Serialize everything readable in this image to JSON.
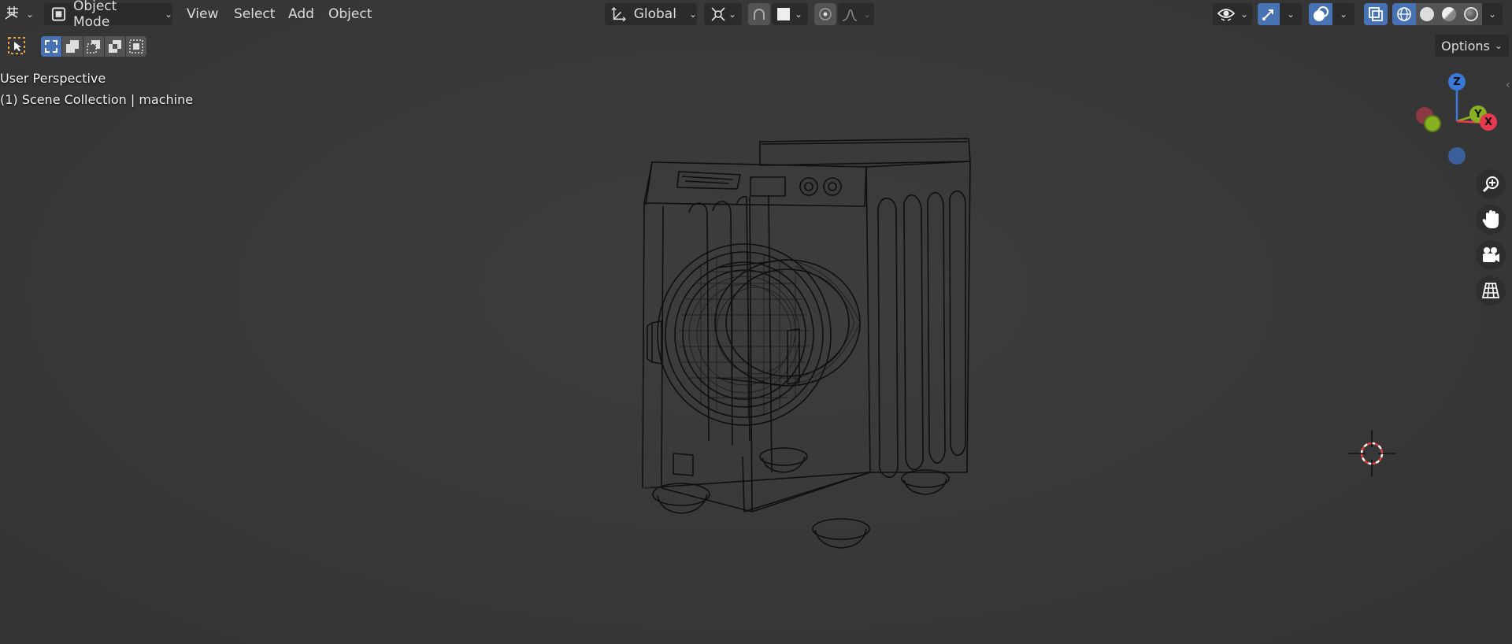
{
  "header": {
    "mode_label": "Object Mode",
    "menus": [
      "View",
      "Select",
      "Add",
      "Object"
    ],
    "transform_orientation": "Global",
    "options_label": "Options"
  },
  "overlay": {
    "view_name": "User Perspective",
    "collection_info": "(1) Scene Collection | machine"
  },
  "gizmo": {
    "axes": [
      "Z",
      "Y",
      "X"
    ],
    "colors": {
      "x": "#e83a4f",
      "y": "#87b121",
      "z": "#3a79d9",
      "neg_x": "#8b3a45",
      "neg_z": "#3a5f9a"
    }
  },
  "colors": {
    "accent": "#4772b3",
    "viewport_bg": "#393939",
    "wire": "#0f0f0f"
  },
  "icons": [
    "editor-type-icon",
    "object-mode-icon",
    "orientation-icon",
    "pivot-icon",
    "snap-icon",
    "snap-target-icon",
    "proportional-icon",
    "falloff-icon",
    "visibility-icon",
    "gizmo-icon",
    "overlay-icon",
    "xray-icon",
    "wireframe-shading-icon",
    "solid-shading-icon",
    "material-shading-icon",
    "rendered-shading-icon",
    "zoom-icon",
    "hand-icon",
    "camera-icon",
    "grid-icon",
    "3d-cursor-icon"
  ]
}
